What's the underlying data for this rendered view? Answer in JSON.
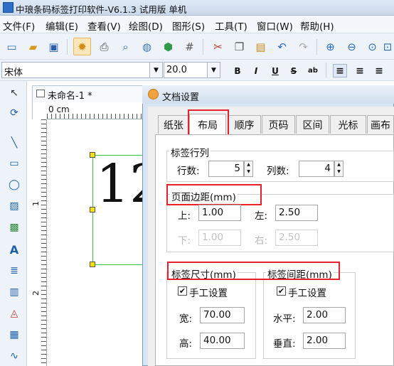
{
  "window": {
    "title": "中琅条码标签打印软件-V6.1.3 试用版 单机"
  },
  "menu": {
    "items": [
      "文件(F)",
      "编辑(E)",
      "查看(V)",
      "绘图(D)",
      "图形(S)",
      "工具(T)",
      "窗口(W)",
      "帮助(H)"
    ]
  },
  "toolbar": {
    "icons": [
      "new-file-icon",
      "open-folder-icon",
      "save-icon",
      "settings-gear-icon",
      "print-icon",
      "print-preview-icon",
      "database-icon",
      "data-source-icon",
      "grid-icon",
      "cut-icon",
      "copy-icon",
      "paste-icon",
      "undo-icon",
      "redo-icon",
      "zoom-in-icon",
      "zoom-out-icon",
      "zoom-fit-icon",
      "fullscreen-icon"
    ]
  },
  "fontbar": {
    "font_name": "宋体",
    "font_size": "20.0",
    "bold": "B",
    "italic": "I",
    "underline": "U",
    "strike": "S",
    "special": "ab"
  },
  "document": {
    "tab_title": "未命名-1 *",
    "ruler_unit": "0 cm",
    "ruler_marks": [
      "1",
      "2"
    ],
    "label_preview_text": "12"
  },
  "dialog": {
    "title": "文档设置",
    "tabs": [
      "纸张",
      "布局",
      "顺序",
      "页码",
      "区间",
      "光标",
      "画布"
    ],
    "selected_tab": "布局",
    "rows_cols": {
      "title": "标签行列",
      "rows_label": "行数:",
      "rows_value": "5",
      "cols_label": "列数:",
      "cols_value": "4"
    },
    "margins": {
      "title": "页面边距(mm)",
      "top_label": "上:",
      "top_value": "1.00",
      "left_label": "左:",
      "left_value": "2.50",
      "bottom_label": "下:",
      "bottom_value": "1.00",
      "right_label": "右:",
      "right_value": "2.50"
    },
    "label_size": {
      "title": "标签尺寸(mm)",
      "manual_label": "手工设置",
      "manual_checked": true,
      "width_label": "宽:",
      "width_value": "70.00",
      "height_label": "高:",
      "height_value": "40.00"
    },
    "label_gap": {
      "title": "标签间距(mm)",
      "manual_label": "手工设置",
      "manual_checked": true,
      "h_label": "水平:",
      "h_value": "2.00",
      "v_label": "垂直:",
      "v_value": "2.00"
    }
  },
  "colors": {
    "highlight": "#e8202a",
    "selection_box": "#3fc43f",
    "handle": "#ffe100"
  }
}
